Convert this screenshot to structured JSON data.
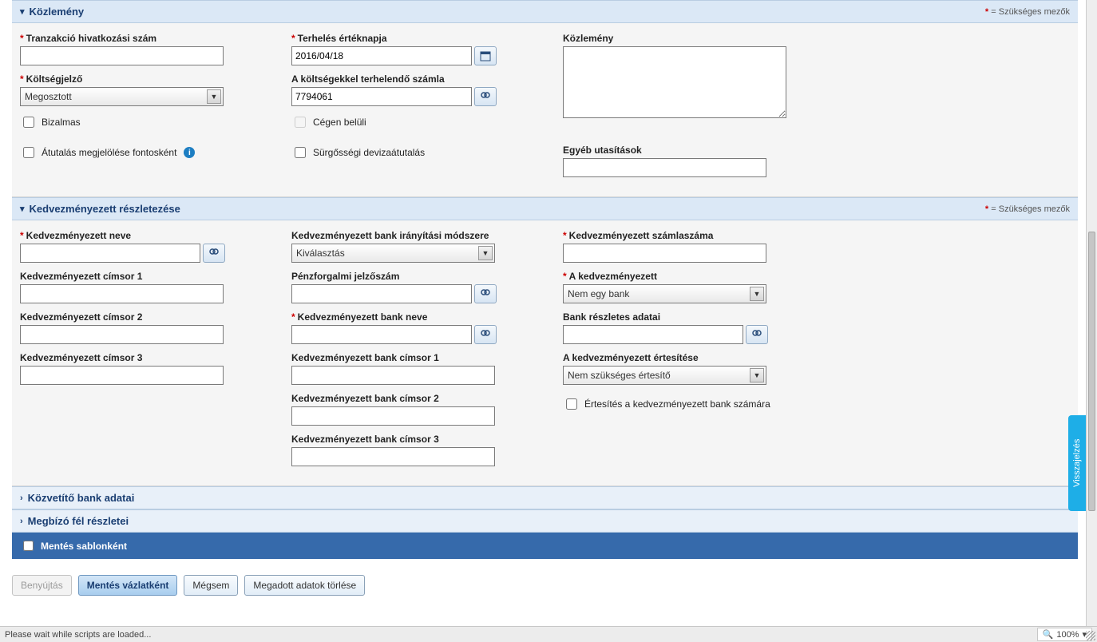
{
  "required_note": "= Szükséges mezők",
  "sections": {
    "kozlemeny": {
      "title": "Közlemény",
      "fields": {
        "tranz_ref": "Tranzakció hivatkozási szám",
        "koltsegjelzo": "Költségjelző",
        "koltsegjelzo_value": "Megosztott",
        "bizalmas": "Bizalmas",
        "atutalas_fontos": "Átutalás megjelölése fontosként",
        "terheles": "Terhelés értéknapja",
        "terheles_value": "2016/04/18",
        "koltseg_szamla": "A költségekkel terhelendő számla",
        "koltseg_szamla_value": "7794061",
        "cegen_belul": "Cégen belüli",
        "surgossegi": "Sürgősségi devizaátutalás",
        "kozlemeny": "Közlemény",
        "egyeb": "Egyéb utasítások"
      }
    },
    "kedv": {
      "title": "Kedvezményezett részletezése",
      "fields": {
        "nev": "Kedvezményezett neve",
        "cim1": "Kedvezményezett címsor 1",
        "cim2": "Kedvezményezett címsor 2",
        "cim3": "Kedvezményezett címsor 3",
        "bank_irany": "Kedvezményezett bank irányítási módszere",
        "bank_irany_value": "Kiválasztás",
        "penzforgalmi": "Pénzforgalmi jelzőszám",
        "bank_neve": "Kedvezményezett bank neve",
        "bank_cim1": "Kedvezményezett bank címsor 1",
        "bank_cim2": "Kedvezményezett bank címsor 2",
        "bank_cim3": "Kedvezményezett bank címsor 3",
        "szamlaszam": "Kedvezményezett számlaszáma",
        "a_kedv": "A kedvezményezett",
        "a_kedv_value": "Nem egy bank",
        "bank_reszletes": "Bank részletes adatai",
        "ertesites": "A kedvezményezett értesítése",
        "ertesites_value": "Nem szükséges értesítő",
        "ertesites_bank": "Értesítés a kedvezményezett bank számára"
      }
    },
    "kozvetito": {
      "title": "Közvetítő bank adatai"
    },
    "megbizo": {
      "title": "Megbízó fél részletei"
    },
    "template": {
      "label": "Mentés sablonként"
    }
  },
  "buttons": {
    "submit": "Benyújtás",
    "save_draft": "Mentés vázlatként",
    "cancel": "Mégsem",
    "clear": "Megadott adatok törlése"
  },
  "status_bar": "Please wait while scripts are loaded...",
  "zoom": "100%",
  "feedback": "Visszajelzés"
}
